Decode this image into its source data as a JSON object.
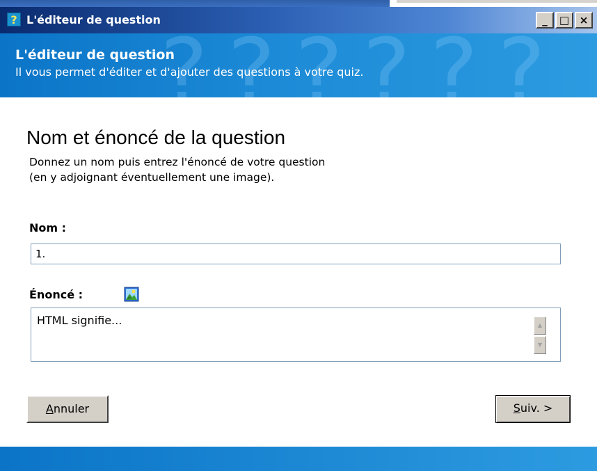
{
  "window": {
    "title": "L'éditeur de question",
    "icon": "question-mark-icon",
    "controls": {
      "minimize": "_",
      "maximize": "□",
      "close": "×"
    }
  },
  "header": {
    "title": "L'éditeur de question",
    "subtitle": "Il vous permet d'éditer et d'ajouter des questions à votre quiz."
  },
  "section": {
    "title": "Nom et énoncé de la question",
    "description_line1": "Donnez un nom puis entrez l'énoncé de votre question",
    "description_line2": "(en y adjoignant éventuellement une image)."
  },
  "form": {
    "name_label": "Nom :",
    "name_value": "1.",
    "statement_label": "Énoncé :",
    "statement_value": "HTML signifie..."
  },
  "buttons": {
    "cancel_mnemonic": "A",
    "cancel_rest": "nnuler",
    "next_mnemonic": "S",
    "next_rest": "uiv. >"
  },
  "colors": {
    "titlebar_start": "#0a2a6e",
    "header_blue": "#1c8ad6",
    "button_face": "#d4d0c8"
  }
}
